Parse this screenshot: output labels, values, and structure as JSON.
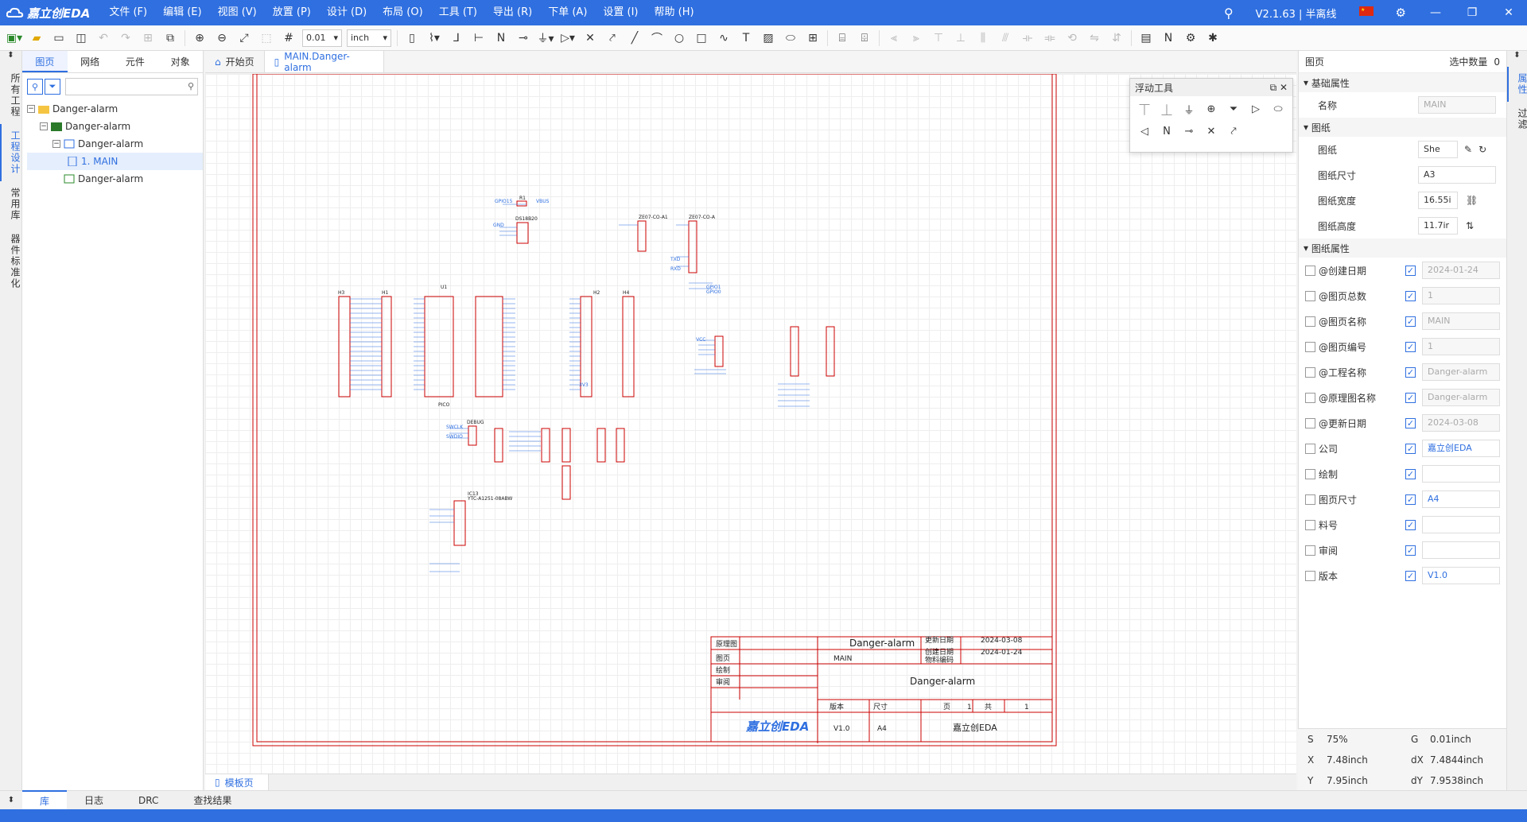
{
  "app": {
    "logo": "嘉立创EDA",
    "version": "V2.1.63 | 半离线"
  },
  "menu": [
    "文件 (F)",
    "编辑 (E)",
    "视图 (V)",
    "放置 (P)",
    "设计 (D)",
    "布局 (O)",
    "工具 (T)",
    "导出 (R)",
    "下单 (A)",
    "设置 (I)",
    "帮助 (H)"
  ],
  "toolbar": {
    "grid": "0.01",
    "unit": "inch"
  },
  "leftrail": [
    "所有工程",
    "工程设计",
    "常用库",
    "器件标准化"
  ],
  "leftpanel": {
    "tabs": [
      "图页",
      "网络",
      "元件",
      "对象"
    ],
    "tree": [
      {
        "label": "Danger-alarm",
        "indent": 0
      },
      {
        "label": "Danger-alarm",
        "indent": 1
      },
      {
        "label": "Danger-alarm",
        "indent": 2
      },
      {
        "label": "1. MAIN",
        "indent": 3
      },
      {
        "label": "Danger-alarm",
        "indent": 2
      }
    ]
  },
  "doctabs": [
    "开始页",
    "MAIN.Danger-alarm"
  ],
  "bottomdoc": "模板页",
  "floattool": {
    "title": "浮动工具"
  },
  "rightpanel": {
    "header": "图页",
    "selcount": "选中数量",
    "selcount_val": "0",
    "sec_basic": "基础属性",
    "name_label": "名称",
    "name_val": "MAIN",
    "sec_sheet": "图纸",
    "sheet_label": "图纸",
    "sheet_val": "She",
    "size_label": "图纸尺寸",
    "size_val": "A3",
    "width_label": "图纸宽度",
    "width_val": "16.55i",
    "height_label": "图纸高度",
    "height_val": "11.7ir",
    "sec_attr": "图纸属性",
    "props": [
      {
        "name": "@创建日期",
        "val": "2024-01-24",
        "style": "grey"
      },
      {
        "name": "@图页总数",
        "val": "1",
        "style": "grey"
      },
      {
        "name": "@图页名称",
        "val": "MAIN",
        "style": "grey"
      },
      {
        "name": "@图页编号",
        "val": "1",
        "style": "grey"
      },
      {
        "name": "@工程名称",
        "val": "Danger-alarm",
        "style": "grey"
      },
      {
        "name": "@原理图名称",
        "val": "Danger-alarm",
        "style": "grey"
      },
      {
        "name": "@更新日期",
        "val": "2024-03-08",
        "style": "grey"
      },
      {
        "name": "公司",
        "val": "嘉立创EDA",
        "style": "blue"
      },
      {
        "name": "绘制",
        "val": "",
        "style": "blue"
      },
      {
        "name": "图页尺寸",
        "val": "A4",
        "style": "blue"
      },
      {
        "name": "料号",
        "val": "",
        "style": "blue"
      },
      {
        "name": "审阅",
        "val": "",
        "style": "blue"
      },
      {
        "name": "版本",
        "val": "V1.0",
        "style": "blue"
      }
    ]
  },
  "rightrail": [
    "属性",
    "过滤"
  ],
  "status": {
    "s": "S",
    "s_val": "75%",
    "g": "G",
    "g_val": "0.01inch",
    "x": "X",
    "x_val": "7.48inch",
    "dx": "dX",
    "dx_val": "7.4844inch",
    "y": "Y",
    "y_val": "7.95inch",
    "dy": "dY",
    "dy_val": "7.9538inch"
  },
  "bottomtabs": [
    "库",
    "日志",
    "DRC",
    "查找结果"
  ],
  "titleblock": {
    "l_schem": "原理图",
    "schem": "Danger-alarm",
    "l_upd": "更新日期",
    "upd": "2024-03-08",
    "l_create": "创建日期",
    "create": "2024-01-24",
    "l_page": "图页",
    "page": "MAIN",
    "l_part": "物料编码",
    "l_draw": "绘制",
    "l_review": "审阅",
    "proj": "Danger-alarm",
    "l_ver": "版本",
    "l_size": "尺寸",
    "l_pg": "页",
    "pg": "1",
    "l_tot": "共",
    "tot": "1",
    "logo": "嘉立创EDA",
    "ver": "V1.0",
    "size": "A4",
    "company": "嘉立创EDA"
  },
  "schematic": {
    "refs": [
      "H3",
      "H1",
      "U1",
      "H2",
      "H4",
      "R1",
      "DS18B20",
      "ZE07-CO-A1",
      "ZE07-CO-A",
      "DEBUG",
      "PICO",
      "IC13",
      "YTC-A1251-08ABW"
    ],
    "nets": [
      "GPIO15",
      "VBUS",
      "GND",
      "3V3",
      "TXD",
      "RXD",
      "VCC",
      "GPIO0",
      "GPIO1",
      "SWCLK",
      "SWDIO"
    ]
  }
}
